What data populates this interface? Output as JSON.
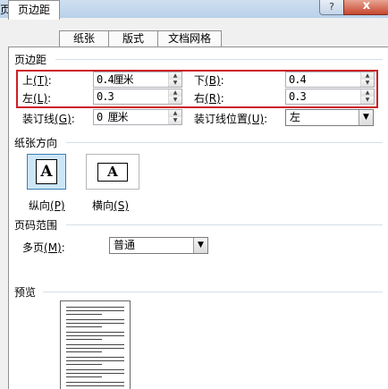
{
  "window": {
    "title": "页面设置",
    "help_label": "?",
    "close_label": "x"
  },
  "tabs": [
    {
      "label": "页边距",
      "active": true
    },
    {
      "label": "纸张",
      "active": false
    },
    {
      "label": "版式",
      "active": false
    },
    {
      "label": "文档网格",
      "active": false
    }
  ],
  "margins": {
    "group_label": "页边距",
    "top": {
      "label": "上",
      "key": "(T)",
      "value": "0.4厘米"
    },
    "bottom": {
      "label": "下",
      "key": "(B)",
      "value": "0.4"
    },
    "left": {
      "label": "左",
      "key": "(L)",
      "value": "0.3"
    },
    "right": {
      "label": "右",
      "key": "(R)",
      "value": "0.3"
    },
    "gutter": {
      "label": "装订线",
      "key": "(G)",
      "value": "0 厘米"
    },
    "gutter_position": {
      "label": "装订线位置",
      "key": "(U)",
      "value": "左"
    },
    "highlight_color": "#cc1f24"
  },
  "orientation": {
    "group_label": "纸张方向",
    "portrait": {
      "label": "纵向",
      "key": "(P)",
      "glyph": "A",
      "selected": true
    },
    "landscape": {
      "label": "横向",
      "key": "(S)",
      "glyph": "A",
      "selected": false
    }
  },
  "pages": {
    "group_label": "页码范围",
    "multiple_pages": {
      "label": "多页",
      "key": "(M)",
      "value": "普通"
    }
  },
  "preview": {
    "group_label": "预览"
  }
}
